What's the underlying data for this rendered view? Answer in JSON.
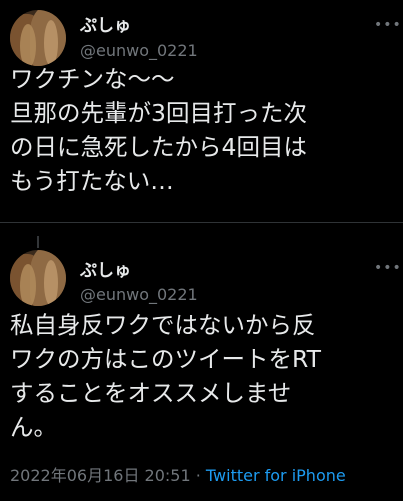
{
  "tweets": [
    {
      "display_name": "ぷしゅ",
      "handle": "@eunwo_0221",
      "more_label": "•••",
      "text": "ワクチンな〜〜\n旦那の先輩が3回目打った次\nの日に急死したから4回目は\nもう打たない…"
    },
    {
      "display_name": "ぷしゅ",
      "handle": "@eunwo_0221",
      "more_label": "•••",
      "text": "私自身反ワクではないから反\nワクの方はこのツイートをRT\nすることをオススメしませ\nん。"
    }
  ],
  "meta": {
    "timestamp": "2022年06月16日 20:51",
    "separator": " · ",
    "source": "Twitter for iPhone"
  }
}
